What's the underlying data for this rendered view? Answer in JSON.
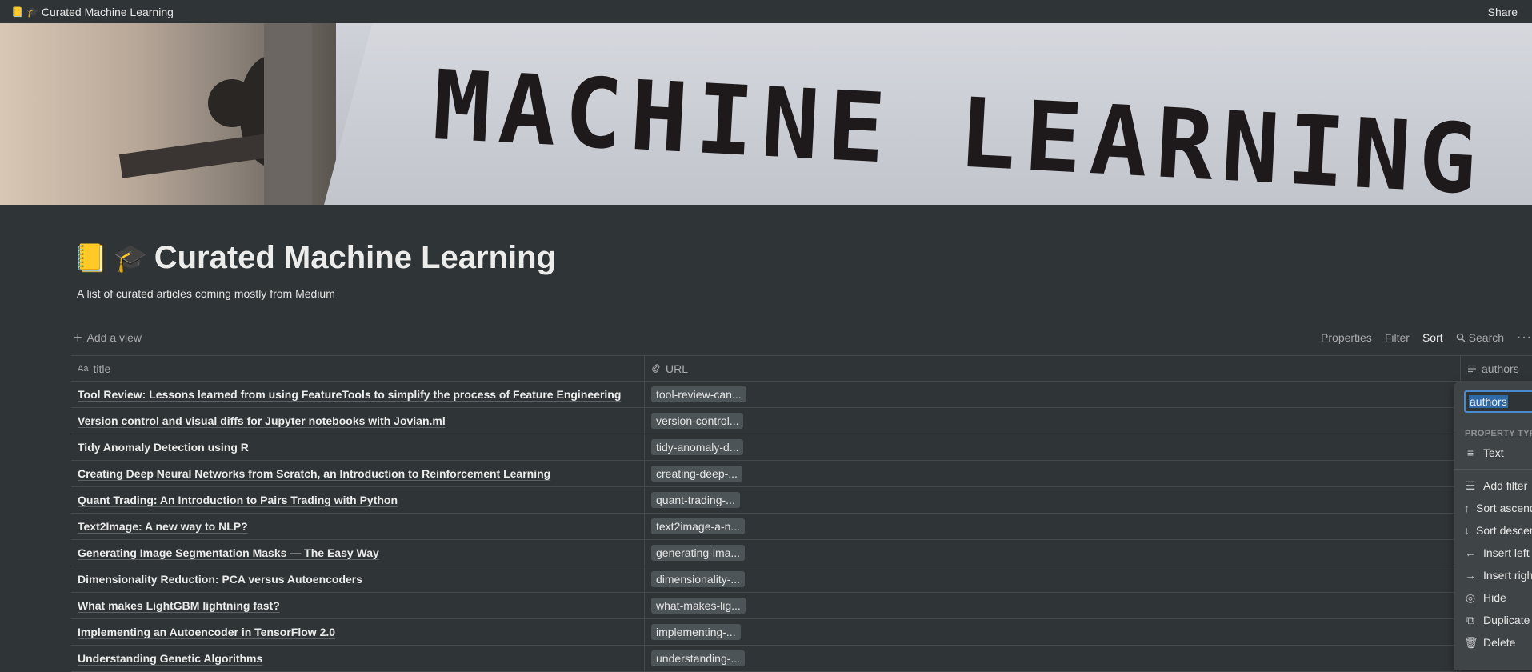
{
  "topbar": {
    "breadcrumb_emoji": "📒",
    "breadcrumb_emoji2": "🎓",
    "breadcrumb_title": "Curated Machine Learning",
    "share_label": "Share"
  },
  "cover": {
    "headline": "MACHINE LEARNING"
  },
  "page": {
    "icon1": "📒",
    "icon2": "🎓",
    "title": "Curated Machine Learning",
    "description": "A list of curated articles coming mostly from Medium"
  },
  "toolbar": {
    "add_view": "Add a view",
    "properties": "Properties",
    "filter": "Filter",
    "sort": "Sort",
    "search": "Search"
  },
  "table": {
    "columns": [
      {
        "label": "title",
        "icon": "Aa"
      },
      {
        "label": "URL",
        "icon": "link-icon"
      },
      {
        "label": "authors",
        "icon": "text-lines-icon"
      }
    ],
    "rows": [
      {
        "title": "Tool Review: Lessons learned from using FeatureTools to simplify the process of Feature Engineering",
        "url": "tool-review-can..."
      },
      {
        "title": "Version control and visual diffs for Jupyter notebooks with Jovian.ml",
        "url": "version-control..."
      },
      {
        "title": "Tidy Anomaly Detection using R",
        "url": "tidy-anomaly-d..."
      },
      {
        "title": "Creating Deep Neural Networks from Scratch, an Introduction to Reinforcement Learning",
        "url": "creating-deep-..."
      },
      {
        "title": "Quant Trading: An Introduction to Pairs Trading with Python",
        "url": "quant-trading-..."
      },
      {
        "title": "Text2Image: A new way to NLP?",
        "url": "text2image-a-n..."
      },
      {
        "title": "Generating Image Segmentation Masks — The Easy Way",
        "url": "generating-ima..."
      },
      {
        "title": "Dimensionality Reduction: PCA versus Autoencoders",
        "url": "dimensionality-..."
      },
      {
        "title": "What makes LightGBM lightning fast?",
        "url": "what-makes-lig..."
      },
      {
        "title": "Implementing an Autoencoder in TensorFlow 2.0",
        "url": "implementing-..."
      },
      {
        "title": "Understanding Genetic Algorithms",
        "url": "understanding-..."
      }
    ]
  },
  "property_menu": {
    "name_value": "authors",
    "section_label": "PROPERTY TYPE",
    "type_label": "Text",
    "items": [
      "Add filter",
      "Sort ascending",
      "Sort descending",
      "Insert left",
      "Insert right",
      "Hide",
      "Duplicate",
      "Delete"
    ]
  },
  "colors": {
    "background": "#2f3437",
    "accent": "#4a8bcf",
    "chip": "#4d5457"
  }
}
